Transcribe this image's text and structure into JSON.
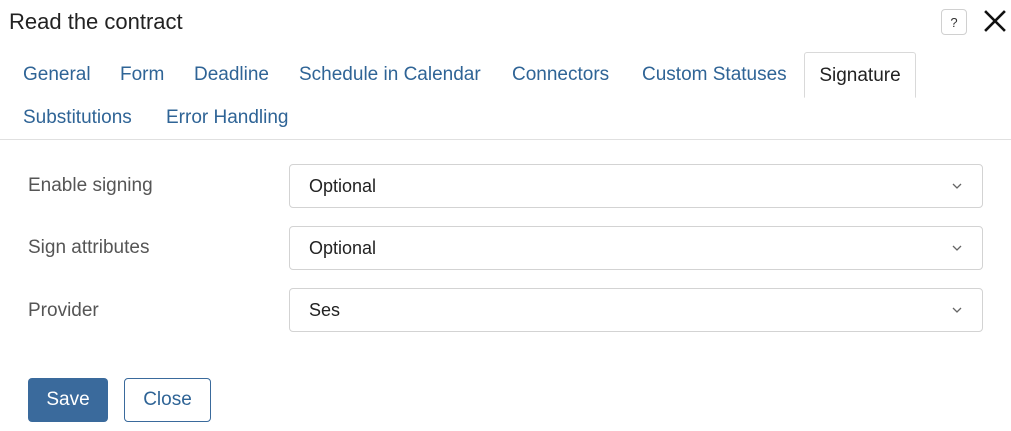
{
  "dialog": {
    "title": "Read the contract",
    "help_label": "?",
    "close_icon": "close-icon"
  },
  "tabs": [
    {
      "label": "General",
      "active": false
    },
    {
      "label": "Form",
      "active": false
    },
    {
      "label": "Deadline",
      "active": false
    },
    {
      "label": "Schedule in Calendar",
      "active": false
    },
    {
      "label": "Connectors",
      "active": false
    },
    {
      "label": "Custom Statuses",
      "active": false
    },
    {
      "label": "Signature",
      "active": true
    },
    {
      "label": "Substitutions",
      "active": false
    },
    {
      "label": "Error Handling",
      "active": false
    }
  ],
  "form": {
    "enable_signing": {
      "label": "Enable signing",
      "value": "Optional"
    },
    "sign_attributes": {
      "label": "Sign attributes",
      "value": "Optional"
    },
    "provider": {
      "label": "Provider",
      "value": "Ses"
    }
  },
  "footer": {
    "save_label": "Save",
    "close_label": "Close"
  },
  "colors": {
    "accent": "#3a6a9c",
    "link": "#2f6496"
  }
}
